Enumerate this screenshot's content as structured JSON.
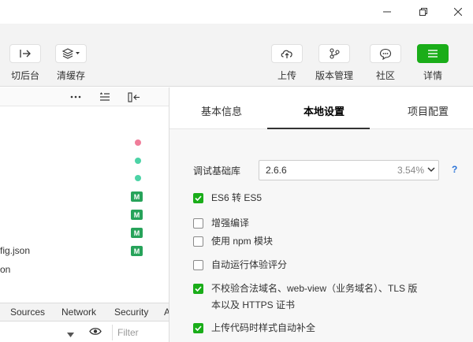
{
  "toolbar": {
    "left_tools": [
      {
        "label": "切后台",
        "icon": "switch-background-icon"
      },
      {
        "label": "清缓存",
        "icon": "layers-icon"
      }
    ],
    "right_tools": [
      {
        "label": "上传",
        "icon": "cloud-upload-icon"
      },
      {
        "label": "版本管理",
        "icon": "branch-icon"
      },
      {
        "label": "社区",
        "icon": "chat-bubble-icon"
      },
      {
        "label": "详情",
        "icon": "menu-icon"
      }
    ]
  },
  "left_panel": {
    "files": [
      "fig.json",
      "on"
    ],
    "status_badge": "M"
  },
  "devtools": {
    "tabs": [
      "Sources",
      "Network",
      "Security",
      "A"
    ],
    "filter_placeholder": "Filter"
  },
  "details": {
    "tabs": [
      "基本信息",
      "本地设置",
      "项目配置"
    ],
    "active_tab": "本地设置",
    "base_library": {
      "label": "调试基础库",
      "value": "2.6.6",
      "percent": "3.54%",
      "help": "?"
    },
    "options": [
      {
        "label": "ES6 转 ES5",
        "checked": true
      },
      {
        "label": "增强编译",
        "checked": false
      },
      {
        "label": "使用 npm 模块",
        "checked": false
      },
      {
        "label": "自动运行体验评分",
        "checked": false
      },
      {
        "label": "不校验合法域名、web-view（业务域名）、TLS 版",
        "label_line2": "本以及 HTTPS 证书",
        "checked": true
      },
      {
        "label": "上传代码时样式自动补全",
        "checked": true
      }
    ]
  },
  "colors": {
    "accent_green": "#1aad19",
    "badge_green": "#27a35a",
    "dot_pink": "#f07d9a",
    "dot_teal": "#4cd3a6",
    "help_blue": "#2b74d8"
  }
}
